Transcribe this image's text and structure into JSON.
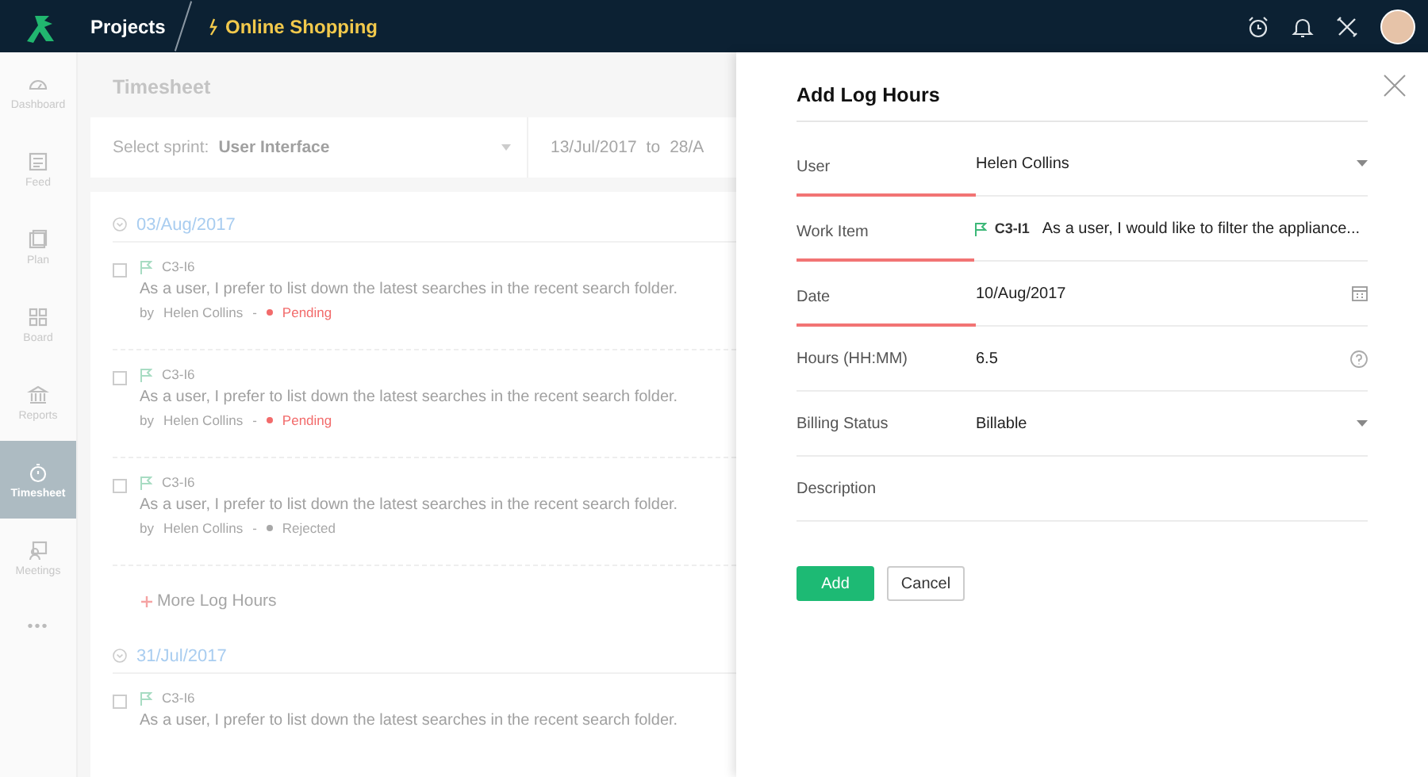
{
  "header": {
    "app": "Projects",
    "project": "Online Shopping"
  },
  "sidebar": {
    "items": [
      {
        "label": "Dashboard",
        "selected": false
      },
      {
        "label": "Feed",
        "selected": false
      },
      {
        "label": "Plan",
        "selected": false
      },
      {
        "label": "Board",
        "selected": false
      },
      {
        "label": "Reports",
        "selected": false
      },
      {
        "label": "Timesheet",
        "selected": true
      },
      {
        "label": "Meetings",
        "selected": false
      }
    ],
    "more": "•••"
  },
  "timesheet": {
    "title": "Timesheet",
    "sprint_label": "Select sprint:",
    "sprint": "User Interface",
    "range_start": "13/Jul/2017",
    "range_to": "to",
    "range_end": "28/A",
    "groups": [
      {
        "date": "03/Aug/2017",
        "entries": [
          {
            "id": "C3-I6",
            "checked": false,
            "text": "As a user, I prefer to list down the latest searches in the recent search folder.",
            "by": "by",
            "user": "Helen Collins",
            "sep": "-",
            "status": "Pending",
            "color": "#f26b6b"
          },
          {
            "id": "C3-I6",
            "checked": false,
            "text": "As a user, I prefer to list down the latest searches in the recent search folder.",
            "by": "by",
            "user": "Helen Collins",
            "sep": "-",
            "status": "Pending",
            "color": "#f26b6b"
          },
          {
            "id": "C3-I6",
            "checked": false,
            "text": "As a user, I prefer to list down the latest searches in the recent search folder.",
            "by": "by",
            "user": "Helen Collins",
            "sep": "-",
            "status": "Rejected",
            "color": "#a8a8a8"
          }
        ],
        "more": "More Log Hours"
      },
      {
        "date": "31/Jul/2017",
        "entries": [
          {
            "id": "C3-I6",
            "checked": false,
            "text": "As a user, I prefer to list down the latest searches in the recent search folder."
          }
        ]
      }
    ]
  },
  "dialog": {
    "title": "Add Log Hours",
    "fields": [
      {
        "label": "User",
        "value": "Helen Collins",
        "kind": "select",
        "required": true
      },
      {
        "label": "Work Item",
        "id": "C3-I1",
        "value": "As a user, I would like to filter the appliance...",
        "kind": "workitem",
        "required": true
      },
      {
        "label": "Date",
        "value": "10/Aug/2017",
        "kind": "date",
        "required": true
      },
      {
        "label": "Hours (HH:MM)",
        "value": "6.5",
        "kind": "help",
        "required": false
      },
      {
        "label": "Billing Status",
        "value": "Billable",
        "kind": "select",
        "required": false
      },
      {
        "label": "Description",
        "kind": "text",
        "required": false
      }
    ],
    "buttons": {
      "primary": "Add",
      "secondary": "Cancel"
    }
  }
}
